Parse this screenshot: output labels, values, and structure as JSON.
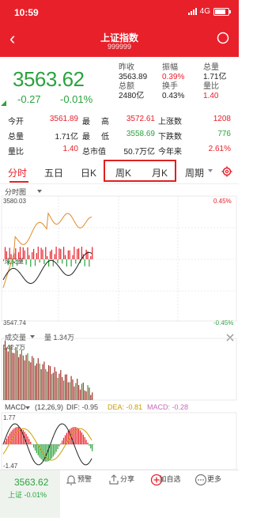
{
  "status_bar": {
    "time": "10:59",
    "network": "4G"
  },
  "header": {
    "title": "上证指数",
    "code": "999999"
  },
  "quote": {
    "price": "3563.62",
    "change": "-0.27",
    "change_pct": "-0.01%",
    "grid": [
      {
        "label": "昨收",
        "value": "3563.89"
      },
      {
        "label": "振幅",
        "value": "0.39%"
      },
      {
        "label": "总量",
        "value": "1.71亿"
      },
      {
        "label": "总额",
        "value": "2480亿"
      },
      {
        "label": "换手",
        "value": "0.43%"
      },
      {
        "label": "量比",
        "value": "1.40"
      }
    ]
  },
  "stats": {
    "row1": {
      "l1": "今开",
      "v1": "3561.89",
      "l2": "最",
      "l3": "高",
      "v2": "3572.61",
      "l4": "上涨数",
      "v3": "1208"
    },
    "row2": {
      "l1": "总量",
      "v1": "1.71亿",
      "l2": "最",
      "l3": "低",
      "v2": "3558.69",
      "l4": "下跌数",
      "v3": "776"
    },
    "row3": {
      "l1": "量比",
      "v1": "1.40",
      "l2": "总市值",
      "v2": "50.7万亿",
      "l4": "今年来",
      "v3": "2.61%"
    }
  },
  "tabs": {
    "fenshi": "分时",
    "wuri": "五日",
    "rik": "日K",
    "zhouk": "周K",
    "yuek": "月K",
    "zhouqi": "周期"
  },
  "timeshare": {
    "title": "分时图",
    "y_high": "3580.03",
    "y_low": "3547.74",
    "pct_high": "0.45%",
    "pct_low": "-0.45%",
    "label_left": "成交量"
  },
  "volume": {
    "label": "成交量",
    "value_label": "量 1.34万",
    "max_label": "142.7万"
  },
  "macd": {
    "label": "MACD",
    "params": "(12,26,9)",
    "dif": "DIF: -0.95",
    "dea": "DEA: -0.81",
    "macd": "MACD: -0.28",
    "y_high": "1.77",
    "y_low": "-1.47"
  },
  "bottom_bar": {
    "price": "3563.62",
    "sub": "上证  -0.01%",
    "items": [
      "预警",
      "分享",
      "加自选",
      "更多"
    ]
  },
  "colors": {
    "red": "#e8202a",
    "green": "#2aa33d"
  }
}
